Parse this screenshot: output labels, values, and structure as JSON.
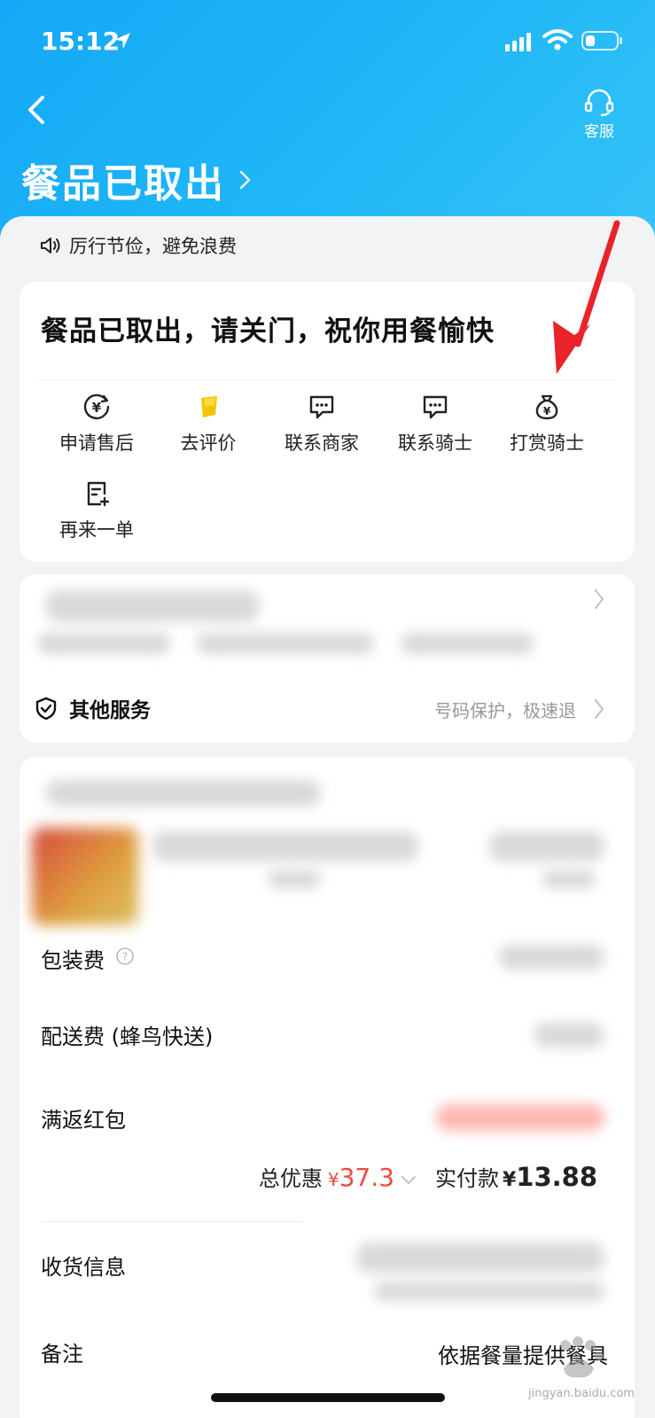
{
  "status_bar": {
    "time": "15:12"
  },
  "header": {
    "service_label": "客服",
    "order_status": "餐品已取出"
  },
  "tip": {
    "text": "厉行节俭，避免浪费"
  },
  "status_card": {
    "message": "餐品已取出，请关门，祝你用餐愉快",
    "actions": [
      {
        "label": "申请售后",
        "icon": "refund-yen-icon"
      },
      {
        "label": "去评价",
        "icon": "review-badge-icon"
      },
      {
        "label": "联系商家",
        "icon": "chat-icon"
      },
      {
        "label": "联系骑士",
        "icon": "chat-icon"
      },
      {
        "label": "打赏骑士",
        "icon": "money-bag-icon"
      },
      {
        "label": "再来一单",
        "icon": "reorder-icon"
      }
    ]
  },
  "service_card": {
    "other_label": "其他服务",
    "other_hint": "号码保护，极速退"
  },
  "detail": {
    "rows": [
      {
        "label": "包装费"
      },
      {
        "label": "配送费 (蜂鸟快送)"
      },
      {
        "label": "满返红包"
      },
      {
        "label": "收货信息"
      },
      {
        "label": "备注"
      }
    ],
    "discount_label": "总优惠",
    "discount_currency": "¥",
    "discount_value": "37.3",
    "paid_label": "实付款",
    "paid_currency": "¥",
    "paid_value": "13.88",
    "remark_value": "依据餐量提供餐具"
  },
  "watermark": {
    "text": "jingyan.baidu.com"
  },
  "colors": {
    "brand": "#1aaef6",
    "discount": "#f0493d",
    "annotation": "#e8242a"
  }
}
